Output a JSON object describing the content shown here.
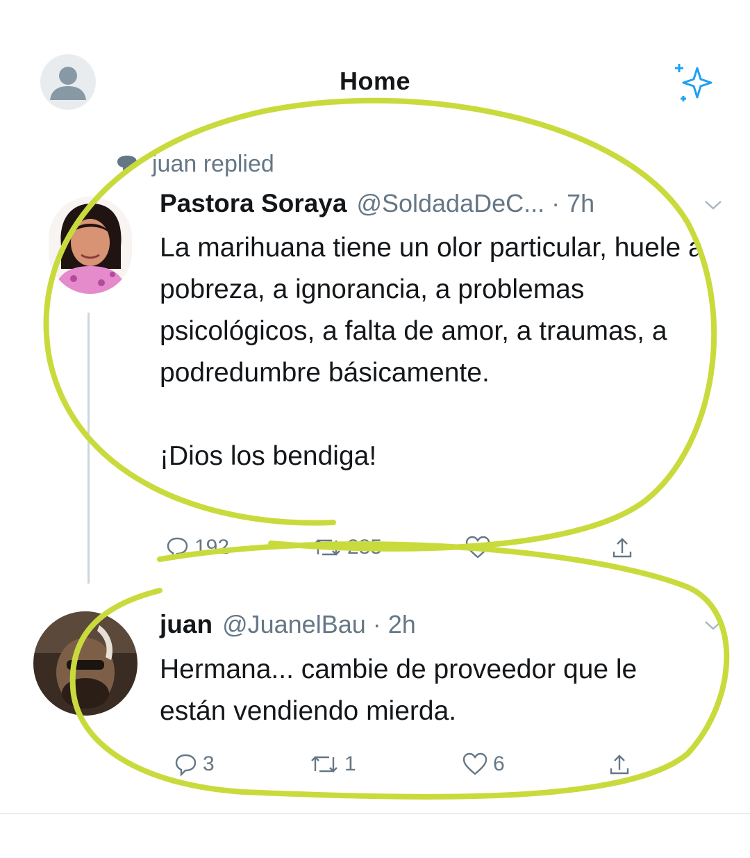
{
  "header": {
    "title": "Home"
  },
  "context": {
    "text": "juan replied"
  },
  "tweets": [
    {
      "name": "Pastora Soraya",
      "handle": "@SoldadaDeC... · 7h",
      "text": "La marihuana tiene un olor particular, huele a pobreza, a ignorancia, a problemas psicológicos, a falta de amor, a traumas, a podredumbre básicamente.\n\n¡Dios los bendiga!",
      "replies": "192",
      "retweets": "285",
      "likes": ""
    },
    {
      "name": "juan",
      "handle": "@JuanelBau · 2h",
      "text": "Hermana... cambie de proveedor que le están vendiendo mierda.",
      "replies": "3",
      "retweets": "1",
      "likes": "6"
    }
  ],
  "icons": {
    "profile": "person-icon",
    "sparkle": "sparkle-icon",
    "context": "speech-bubble-icon",
    "reply": "reply-icon",
    "retweet": "retweet-icon",
    "like": "heart-icon",
    "share": "share-icon",
    "menu": "chevron-down-icon"
  },
  "colors": {
    "accent": "#1da1f2",
    "muted": "#657786",
    "highlight": "#c9db3c"
  }
}
